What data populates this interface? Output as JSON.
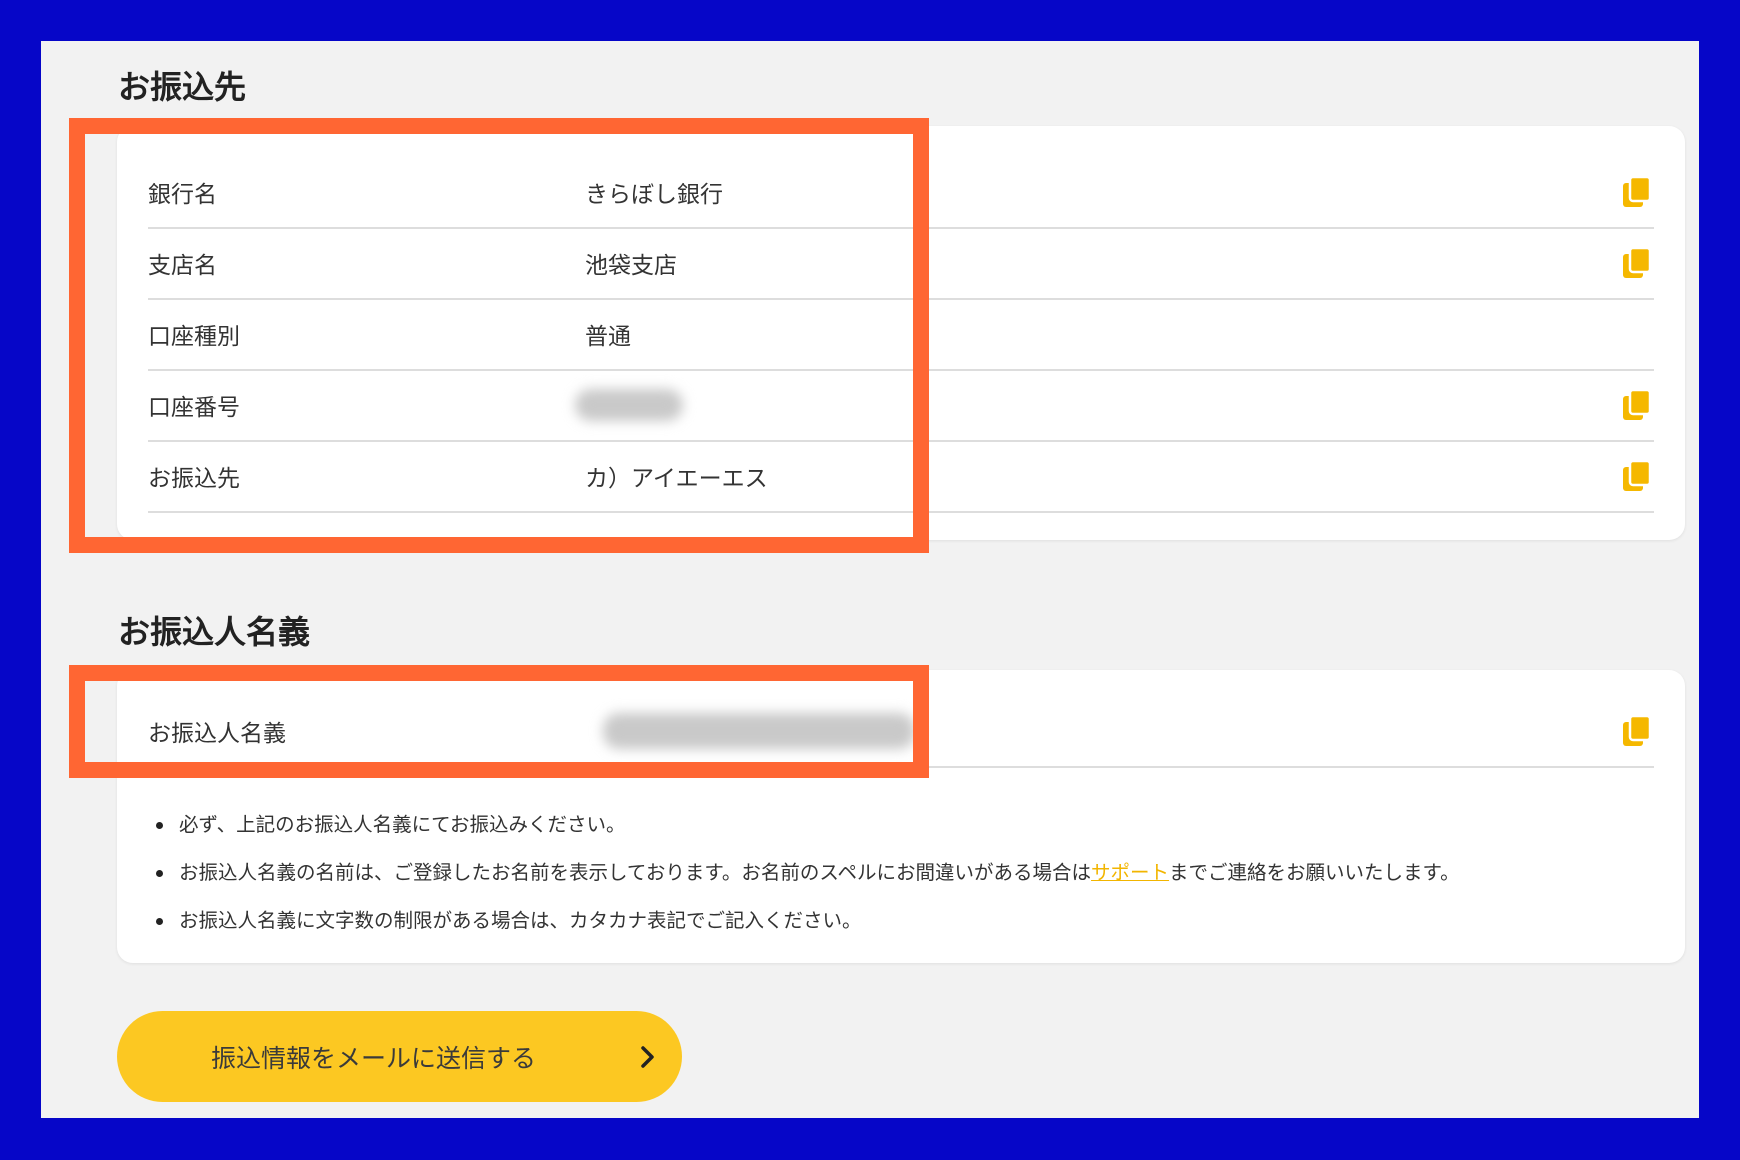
{
  "payee_section": {
    "title": "お振込先",
    "rows": [
      {
        "label": "銀行名",
        "value": "きらぼし銀行",
        "copy_icon": "copy-icon"
      },
      {
        "label": "支店名",
        "value": "池袋支店",
        "copy_icon": "copy-icon"
      },
      {
        "label": "口座種別",
        "value": "普通"
      },
      {
        "label": "口座番号",
        "value_state": "blurred",
        "copy_icon": "copy-icon"
      },
      {
        "label": "お振込先",
        "value": "カ）アイエーエス",
        "copy_icon": "copy-icon"
      }
    ]
  },
  "payer_section": {
    "title": "お振込人名義",
    "row": {
      "label": "お振込人名義",
      "value_state": "blurred",
      "copy_icon": "copy-icon"
    },
    "notes": [
      {
        "text": "必ず、上記のお振込人名義にてお振込みください。"
      },
      {
        "text_before": "お振込人名義の名前は、ご登録したお名前を表示しております。お名前のスペルにお間違いがある場合は",
        "link": "サポート",
        "text_after": "までご連絡をお願いいたします。"
      },
      {
        "text": "お振込人名義に文字数の制限がある場合は、カタカナ表記でご記入ください。"
      }
    ]
  },
  "send_button": {
    "label": "振込情報をメールに送信する",
    "icon": "chevron-right-icon"
  },
  "colors": {
    "frame": "#0606c8",
    "background": "#f2f2f2",
    "card": "#ffffff",
    "highlight": "#ff6633",
    "accent": "#fcc822",
    "copy_icon": "#f5b800",
    "link": "#f2b500"
  }
}
